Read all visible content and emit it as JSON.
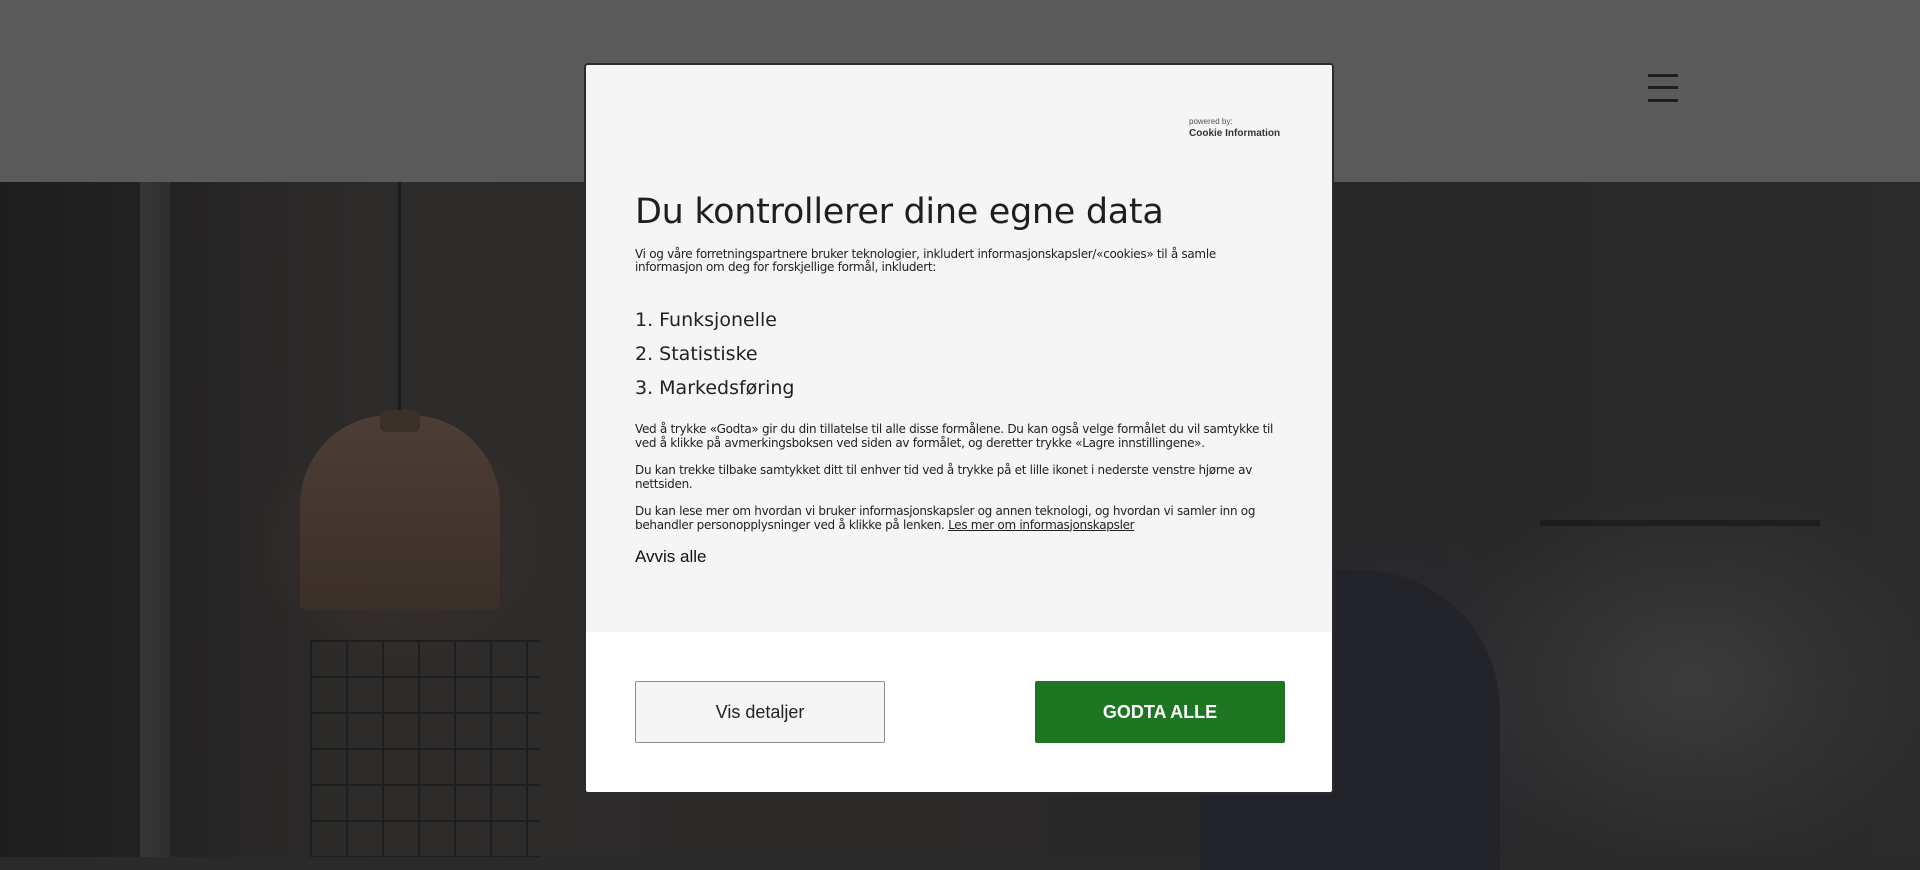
{
  "colors": {
    "accept_green": "#1e7522",
    "modal_body_bg": "#f5f5f5",
    "header_bg": "#5a5a5a"
  },
  "header": {
    "menu_icon": "hamburger-menu-icon"
  },
  "cookie_dialog": {
    "powered_by_label": "powered by:",
    "powered_by_brand": "Cookie Information",
    "title": "Du kontrollerer dine egne data",
    "intro": "Vi og våre forretningspartnere bruker teknologier, inkludert informasjonskapsler/«cookies» til å samle informasjon om deg for forskjellige formål, inkludert:",
    "purposes": [
      "1. Funksjonelle",
      "2. Statistiske",
      "3. Markedsføring"
    ],
    "paragraph_consent": "Ved å trykke «Godta» gir du din tillatelse til alle disse formålene. Du kan også velge formålet du vil samtykke til ved å klikke på avmerkingsboksen ved siden av formålet, og deretter trykke «Lagre innstillingene».",
    "paragraph_withdraw": "Du kan trekke tilbake samtykket ditt til enhver tid ved å trykke på et lille ikonet i nederste venstre hjørne av nettsiden.",
    "paragraph_more": "Du kan lese mer om hvordan vi bruker informasjonskapsler og annen teknologi, og hvordan vi samler inn og behandler personopplysninger ved å klikke på lenken.",
    "more_link": "Les mer om informasjonskapsler",
    "reject_all": "Avvis alle",
    "details_button": "Vis detaljer",
    "accept_all_button": "GODTA ALLE"
  }
}
